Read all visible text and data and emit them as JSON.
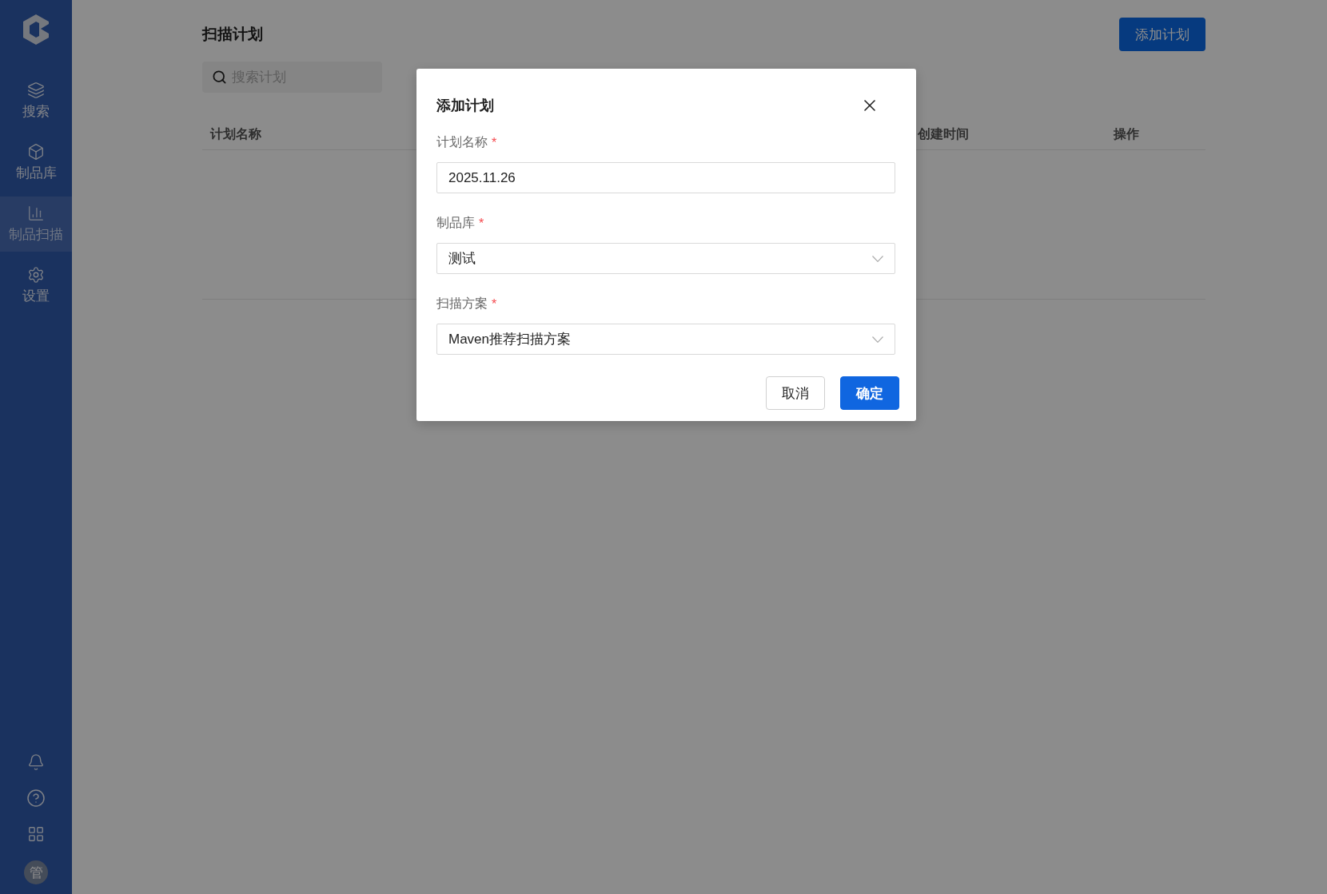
{
  "sidebar": {
    "items": [
      {
        "label": "搜索",
        "selected": false
      },
      {
        "label": "制品库",
        "selected": false
      },
      {
        "label": "制品扫描",
        "selected": true
      },
      {
        "label": "设置",
        "selected": false
      }
    ],
    "avatar": "管"
  },
  "page": {
    "title": "扫描计划",
    "add_button": "添加计划",
    "search": {
      "placeholder": "搜索计划"
    },
    "table": {
      "columns": [
        {
          "label": "计划名称"
        },
        {
          "label": "创建时间"
        },
        {
          "label": "操作"
        }
      ]
    }
  },
  "dialog": {
    "title": "添加计划",
    "fields": [
      {
        "kind": "input",
        "label": "计划名称",
        "required_mark": "*",
        "value": "2025.11.26"
      },
      {
        "kind": "select",
        "label": "制品库",
        "required_mark": "*",
        "value": "测试"
      },
      {
        "kind": "select",
        "label": "扫描方案",
        "required_mark": "*",
        "value": "Maven推荐扫描方案"
      }
    ],
    "buttons": [
      {
        "label": "取消",
        "kind": "secondary"
      },
      {
        "label": "确定",
        "kind": "primary"
      }
    ]
  }
}
